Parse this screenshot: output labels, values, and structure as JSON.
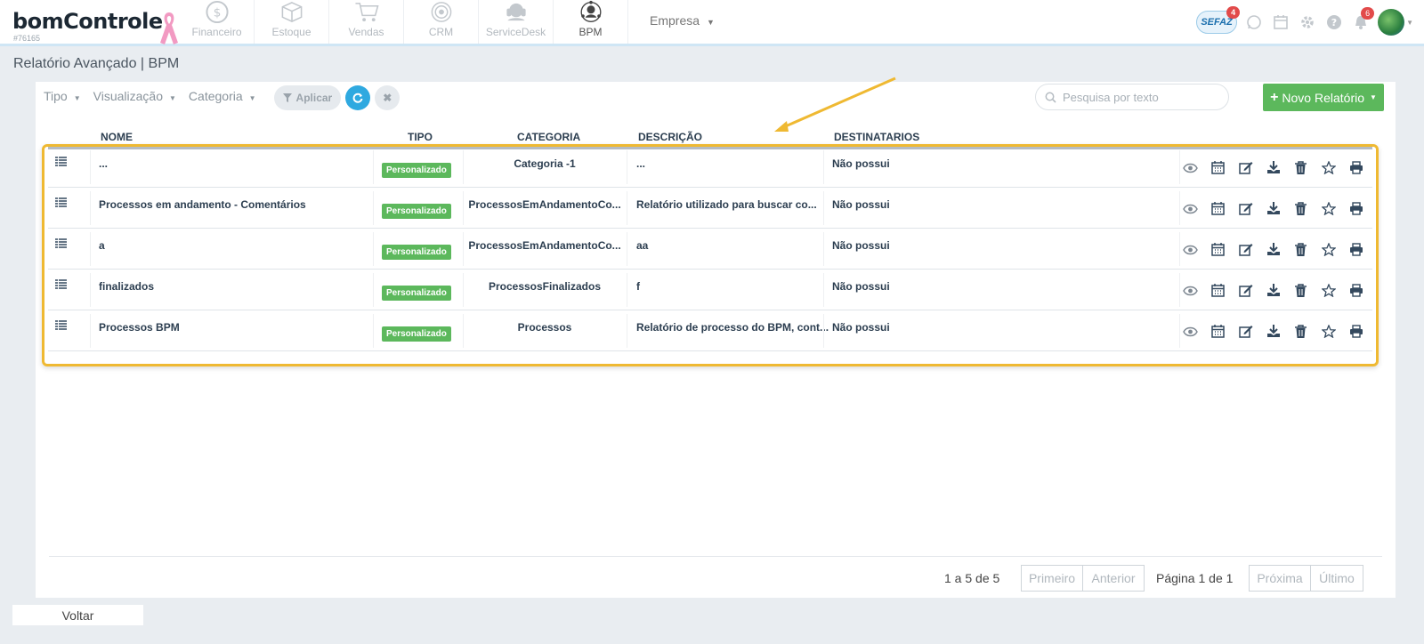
{
  "brand": {
    "logo": "bomControle",
    "account_id": "#76165"
  },
  "modules": [
    {
      "label": "Financeiro",
      "icon": "dollar-icon"
    },
    {
      "label": "Estoque",
      "icon": "box-icon"
    },
    {
      "label": "Vendas",
      "icon": "cart-icon"
    },
    {
      "label": "CRM",
      "icon": "target-icon"
    },
    {
      "label": "ServiceDesk",
      "icon": "headset-icon"
    },
    {
      "label": "BPM",
      "icon": "bpm-icon"
    }
  ],
  "empresa_label": "Empresa",
  "top_right": {
    "sefaz_label": "SEFAZ",
    "sefaz_badge": "4",
    "notifications_badge": "6"
  },
  "page_title": "Relatório Avançado | BPM",
  "filters": {
    "tipo": "Tipo",
    "visualizacao": "Visualização",
    "categoria": "Categoria",
    "apply": "Aplicar"
  },
  "search": {
    "placeholder": "Pesquisa por texto"
  },
  "new_report": "Novo Relatório",
  "columns": {
    "nome": "NOME",
    "tipo": "TIPO",
    "categoria": "CATEGORIA",
    "descricao": "DESCRIÇÃO",
    "destinatarios": "DESTINATARIOS"
  },
  "rows": [
    {
      "nome": "...",
      "tipo": "Personalizado",
      "categoria": "Categoria -1",
      "descricao": "...",
      "destinatarios": "Não possui"
    },
    {
      "nome": "Processos em andamento - Comentários",
      "tipo": "Personalizado",
      "categoria": "ProcessosEmAndamentoCo...",
      "descricao": "Relatório utilizado para buscar co...",
      "destinatarios": "Não possui"
    },
    {
      "nome": "a",
      "tipo": "Personalizado",
      "categoria": "ProcessosEmAndamentoCo...",
      "descricao": "aa",
      "destinatarios": "Não possui"
    },
    {
      "nome": "finalizados",
      "tipo": "Personalizado",
      "categoria": "ProcessosFinalizados",
      "descricao": "f",
      "destinatarios": "Não possui"
    },
    {
      "nome": "Processos BPM",
      "tipo": "Personalizado",
      "categoria": "Processos",
      "descricao": "Relatório de processo do BPM, cont...",
      "destinatarios": "Não possui"
    }
  ],
  "pagination": {
    "count": "1 a 5 de 5",
    "first": "Primeiro",
    "prev": "Anterior",
    "page": "Página 1 de 1",
    "next": "Próxima",
    "last": "Último"
  },
  "back_label": "Voltar",
  "colors": {
    "accent_green": "#5cb85c",
    "refresh_blue": "#2fa9e0",
    "highlight": "#efb932"
  }
}
